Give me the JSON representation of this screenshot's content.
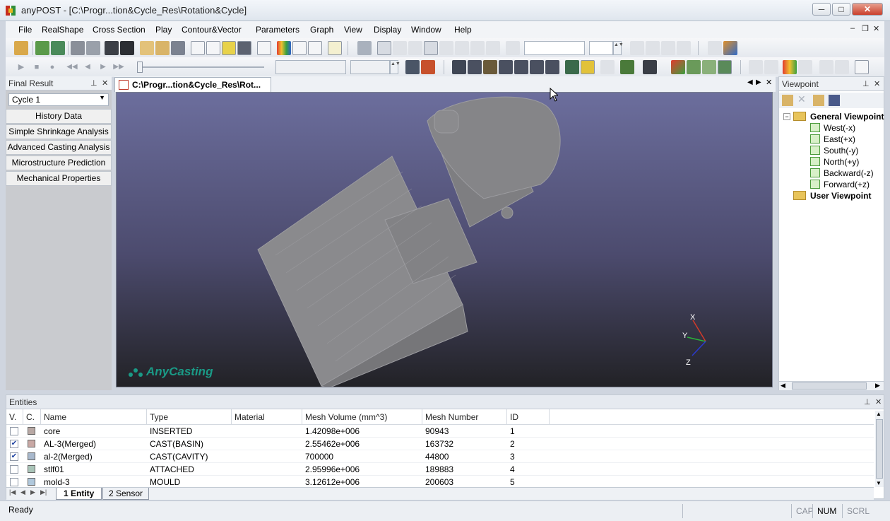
{
  "window": {
    "title": "anyPOST - [C:\\Progr...tion&Cycle_Res\\Rotation&Cycle]",
    "minimize": "─",
    "maximize": "□",
    "close": "✕"
  },
  "menu": [
    "File",
    "RealShape",
    "Cross Section",
    "Play",
    "Contour&Vector",
    "Parameters",
    "Graph",
    "View",
    "Display",
    "Window",
    "Help"
  ],
  "mdi_controls": {
    "minimize": "‒",
    "restore": "❐",
    "close": "✕"
  },
  "left_panel": {
    "title": "Final Result",
    "cycle_value": "Cycle 1",
    "buttons": [
      "History Data",
      "Simple Shrinkage Analysis",
      "Advanced Casting Analysis",
      "Microstructure Prediction",
      "Mechanical Properties"
    ]
  },
  "document": {
    "tab_label": "C:\\Progr...tion&Cycle_Res\\Rot...",
    "logo_text": "AnyCasting",
    "axes": {
      "x": "X",
      "y": "Y",
      "z": "Z"
    }
  },
  "viewpoint": {
    "title": "Viewpoint",
    "general": "General Viewpoint",
    "items": [
      "West(-x)",
      "East(+x)",
      "South(-y)",
      "North(+y)",
      "Backward(-z)",
      "Forward(+z)"
    ],
    "user": "User Viewpoint"
  },
  "entities": {
    "title": "Entities",
    "columns": [
      "V.",
      "C.",
      "Name",
      "Type",
      "Material",
      "Mesh Volume (mm^3)",
      "Mesh Number",
      "ID"
    ],
    "rows": [
      {
        "visible": false,
        "color": "#b8a8a4",
        "name": "core",
        "type": "INSERTED",
        "material": "",
        "volume": "1.42098e+006",
        "mesh": "90943",
        "id": "1"
      },
      {
        "visible": true,
        "color": "#c8a8a4",
        "name": "AL-3(Merged)",
        "type": "CAST(BASIN)",
        "material": "",
        "volume": "2.55462e+006",
        "mesh": "163732",
        "id": "2"
      },
      {
        "visible": true,
        "color": "#a8b8cc",
        "name": "al-2(Merged)",
        "type": "CAST(CAVITY)",
        "material": "",
        "volume": "700000",
        "mesh": "44800",
        "id": "3"
      },
      {
        "visible": false,
        "color": "#a9c4b8",
        "name": "stlf01",
        "type": "ATTACHED",
        "material": "",
        "volume": "2.95996e+006",
        "mesh": "189883",
        "id": "4"
      },
      {
        "visible": false,
        "color": "#b0c8dc",
        "name": "mold-3",
        "type": "MOULD",
        "material": "",
        "volume": "3.12612e+006",
        "mesh": "200603",
        "id": "5"
      }
    ],
    "sheet_tabs": [
      "1 Entity",
      "2 Sensor"
    ]
  },
  "status": {
    "text": "Ready",
    "cap": "CAP",
    "num": "NUM",
    "scrl": "SCRL"
  },
  "colors": {
    "accent": "#1a9a86",
    "viewport_top": "#6c6e9d",
    "viewport_bottom": "#222226"
  }
}
